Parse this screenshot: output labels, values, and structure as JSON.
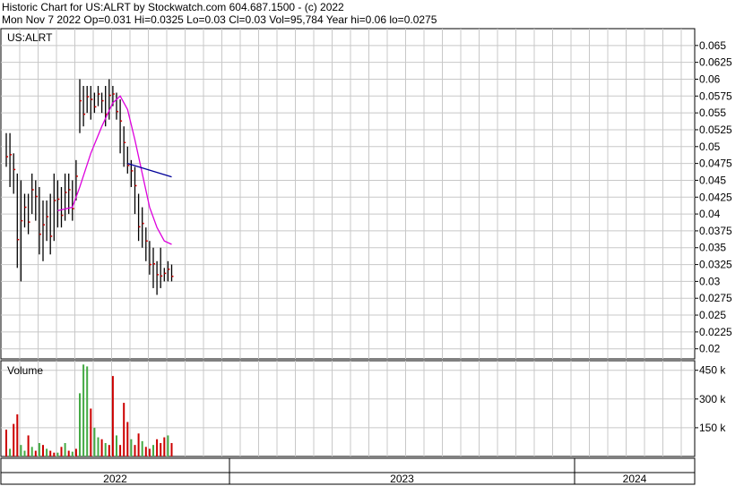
{
  "header": {
    "line1": "Historic Chart for US:ALRT by Stockwatch.com 604.687.1500 - (c) 2022",
    "line2": "Mon Nov  7 2022   Op=0.031  Hi=0.0325  Lo=0.03  Cl=0.03  Vol=95,784  Year hi=0.06  lo=0.0275"
  },
  "colors": {
    "price_bar": "#000000",
    "close_tick": "#cc0000",
    "ma_short": "#dd00dd",
    "ma_long": "#000099",
    "vol_up": "#44aa44",
    "vol_down": "#cc0000",
    "grid": "#c8c8c8"
  },
  "chart_data": [
    {
      "type": "line",
      "title": "US:ALRT",
      "y_ticks": [
        "0.065",
        "0.0625",
        "0.06",
        "0.0575",
        "0.055",
        "0.0525",
        "0.05",
        "0.0475",
        "0.045",
        "0.0425",
        "0.04",
        "0.0375",
        "0.035",
        "0.0325",
        "0.03",
        "0.0275",
        "0.025",
        "0.0225",
        "0.02"
      ],
      "ylim": [
        0.0185,
        0.0675
      ],
      "x_ticks": [
        "2022",
        "2023",
        "2024"
      ],
      "grid": true,
      "series": [
        {
          "kind": "hl_bars",
          "points": [
            [
              0,
              0.047,
              0.052
            ],
            [
              1,
              0.044,
              0.052
            ],
            [
              2,
              0.043,
              0.049
            ],
            [
              3,
              0.032,
              0.046
            ],
            [
              4,
              0.03,
              0.045
            ],
            [
              5,
              0.038,
              0.043
            ],
            [
              6,
              0.037,
              0.043
            ],
            [
              7,
              0.04,
              0.046
            ],
            [
              8,
              0.039,
              0.045
            ],
            [
              9,
              0.034,
              0.044
            ],
            [
              10,
              0.033,
              0.042
            ],
            [
              11,
              0.036,
              0.042
            ],
            [
              12,
              0.034,
              0.043
            ],
            [
              13,
              0.036,
              0.046
            ],
            [
              14,
              0.038,
              0.045
            ],
            [
              15,
              0.038,
              0.044
            ],
            [
              16,
              0.039,
              0.046
            ],
            [
              17,
              0.04,
              0.046
            ],
            [
              18,
              0.039,
              0.045
            ],
            [
              19,
              0.042,
              0.048
            ],
            [
              20,
              0.052,
              0.06
            ],
            [
              21,
              0.053,
              0.059
            ],
            [
              22,
              0.055,
              0.059
            ],
            [
              23,
              0.054,
              0.059
            ],
            [
              24,
              0.055,
              0.058
            ],
            [
              25,
              0.056,
              0.059
            ],
            [
              26,
              0.055,
              0.058
            ],
            [
              27,
              0.053,
              0.059
            ],
            [
              28,
              0.054,
              0.06
            ],
            [
              29,
              0.056,
              0.059
            ],
            [
              30,
              0.054,
              0.058
            ],
            [
              31,
              0.049,
              0.057
            ],
            [
              32,
              0.047,
              0.053
            ],
            [
              33,
              0.046,
              0.05
            ],
            [
              34,
              0.044,
              0.048
            ],
            [
              35,
              0.04,
              0.047
            ],
            [
              36,
              0.036,
              0.043
            ],
            [
              37,
              0.035,
              0.041
            ],
            [
              38,
              0.033,
              0.038
            ],
            [
              39,
              0.031,
              0.036
            ],
            [
              40,
              0.029,
              0.035
            ],
            [
              41,
              0.028,
              0.033
            ],
            [
              42,
              0.029,
              0.035
            ],
            [
              43,
              0.03,
              0.032
            ],
            [
              44,
              0.03,
              0.033
            ],
            [
              45,
              0.03,
              0.0325
            ]
          ]
        },
        {
          "kind": "ma_short",
          "points": [
            [
              14,
              0.0405
            ],
            [
              18,
              0.041
            ],
            [
              20,
              0.044
            ],
            [
              23,
              0.049
            ],
            [
              26,
              0.053
            ],
            [
              29,
              0.0565
            ],
            [
              31,
              0.0575
            ],
            [
              33,
              0.0555
            ],
            [
              35,
              0.051
            ],
            [
              37,
              0.046
            ],
            [
              39,
              0.041
            ],
            [
              41,
              0.038
            ],
            [
              43,
              0.036
            ],
            [
              45,
              0.0355
            ]
          ]
        },
        {
          "kind": "ma_long",
          "points": [
            [
              33,
              0.0475
            ],
            [
              36,
              0.047
            ],
            [
              39,
              0.0465
            ],
            [
              42,
              0.046
            ],
            [
              45,
              0.0455
            ]
          ]
        }
      ]
    },
    {
      "type": "bar",
      "title": "Volume",
      "y_ticks": [
        "450 k",
        "300 k",
        "150 k"
      ],
      "ylim": [
        0,
        500000
      ],
      "values": [
        140000,
        40000,
        170000,
        220000,
        60000,
        30000,
        110000,
        50000,
        30000,
        70000,
        60000,
        40000,
        30000,
        20000,
        20000,
        50000,
        70000,
        30000,
        25000,
        40000,
        330000,
        480000,
        470000,
        250000,
        150000,
        100000,
        90000,
        70000,
        60000,
        420000,
        110000,
        60000,
        280000,
        180000,
        90000,
        60000,
        120000,
        80000,
        50000,
        40000,
        60000,
        90000,
        70000,
        100000,
        110000,
        70000
      ],
      "up": [
        false,
        true,
        false,
        false,
        true,
        true,
        false,
        true,
        false,
        true,
        false,
        true,
        false,
        false,
        true,
        false,
        true,
        false,
        true,
        false,
        true,
        true,
        true,
        false,
        true,
        true,
        false,
        true,
        false,
        false,
        true,
        false,
        false,
        false,
        true,
        false,
        false,
        true,
        false,
        false,
        true,
        false,
        false,
        false,
        true,
        false
      ]
    }
  ]
}
